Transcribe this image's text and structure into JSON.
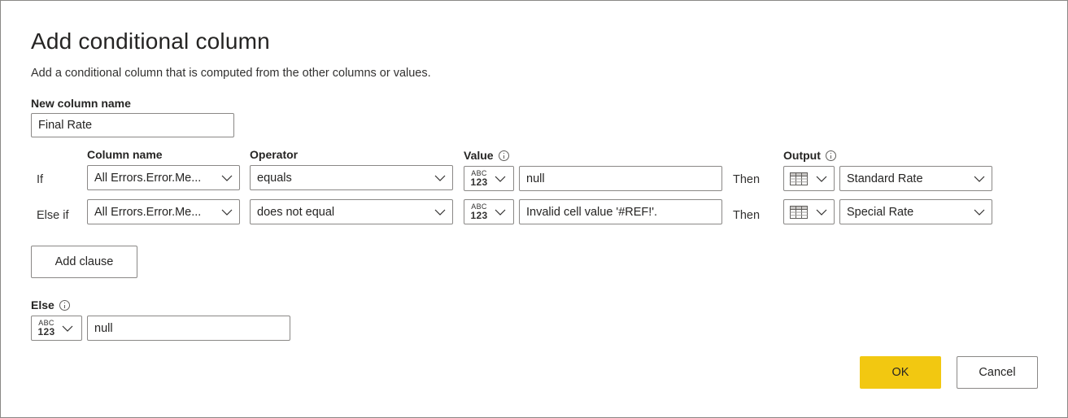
{
  "dialog": {
    "title": "Add conditional column",
    "subtitle": "Add a conditional column that is computed from the other columns or values."
  },
  "new_column": {
    "label": "New column name",
    "value": "Final Rate"
  },
  "headers": {
    "column_name": "Column name",
    "operator": "Operator",
    "value": "Value",
    "output": "Output"
  },
  "type_badge": {
    "top": "ABC",
    "bottom": "123"
  },
  "clauses": [
    {
      "label": "If",
      "column": "All Errors.Error.Me...",
      "operator": "equals",
      "value": "null",
      "then_label": "Then",
      "output": "Standard Rate"
    },
    {
      "label": "Else if",
      "column": "All Errors.Error.Me...",
      "operator": "does not equal",
      "value": "Invalid cell value '#REF!'.",
      "then_label": "Then",
      "output": "Special Rate"
    }
  ],
  "add_clause_label": "Add clause",
  "else": {
    "label": "Else",
    "value": "null"
  },
  "buttons": {
    "ok": "OK",
    "cancel": "Cancel"
  },
  "colors": {
    "primary_button": "#f2c811",
    "border": "#8a8886"
  },
  "icons": {
    "info": "info-icon",
    "chevron": "chevron-down-icon",
    "column_type": "column-table-icon",
    "value_type": "any-type-abc123-icon"
  }
}
